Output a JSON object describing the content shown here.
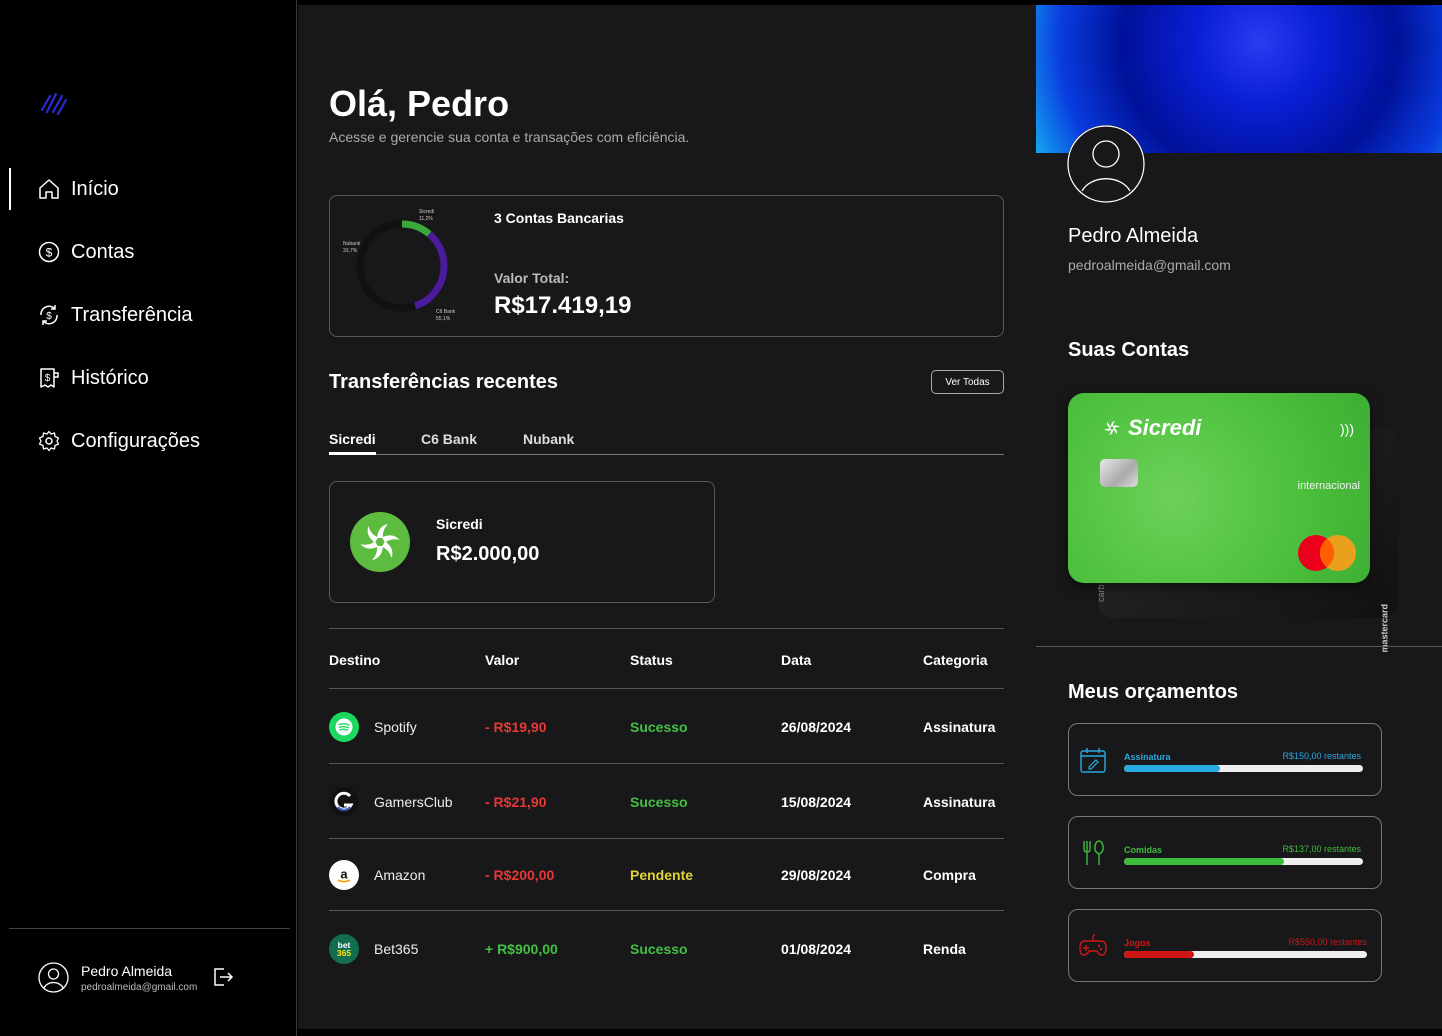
{
  "sidebar": {
    "nav": [
      {
        "label": "Início",
        "icon": "home-icon",
        "active": true
      },
      {
        "label": "Contas",
        "icon": "dollar-circle-icon"
      },
      {
        "label": "Transferência",
        "icon": "transfer-icon"
      },
      {
        "label": "Histórico",
        "icon": "receipt-icon"
      },
      {
        "label": "Configurações",
        "icon": "gear-icon"
      }
    ],
    "user": {
      "name": "Pedro Almeida",
      "email": "pedroalmeida@gmail.com"
    }
  },
  "main": {
    "greeting": "Olá, Pedro",
    "subtitle": "Acesse e gerencie sua conta e transações com eficiência.",
    "summary": {
      "accounts_label": "3 Contas Bancarias",
      "total_label": "Valor Total:",
      "total_value": "R$17.419,19",
      "donut": [
        {
          "name": "Sicredi",
          "pct": "11,2%",
          "value": 11.2,
          "color": "#3aa83a"
        },
        {
          "name": "Nubank",
          "pct": "33,7%",
          "value": 33.7,
          "color": "#4a1c9c"
        },
        {
          "name": "C6 Bank",
          "pct": "55,1%",
          "value": 55.1,
          "color": "#111111"
        }
      ]
    },
    "recent": {
      "title": "Transferências recentes",
      "see_all": "Ver Todas",
      "tabs": [
        "Sicredi",
        "C6 Bank",
        "Nubank"
      ],
      "account": {
        "name": "Sicredi",
        "balance": "R$2.000,00"
      }
    },
    "table": {
      "headers": [
        "Destino",
        "Valor",
        "Status",
        "Data",
        "Categoria"
      ],
      "rows": [
        {
          "dest": "Spotify",
          "icon": "spotify-icon",
          "value": "- R$19,90",
          "sign": "neg",
          "status": "Sucesso",
          "stype": "ok",
          "date": "26/08/2024",
          "cat": "Assinatura"
        },
        {
          "dest": "GamersClub",
          "icon": "gamersclub-icon",
          "value": "- R$21,90",
          "sign": "neg",
          "status": "Sucesso",
          "stype": "ok",
          "date": "15/08/2024",
          "cat": "Assinatura"
        },
        {
          "dest": "Amazon",
          "icon": "amazon-icon",
          "value": "- R$200,00",
          "sign": "neg",
          "status": "Pendente",
          "stype": "pend",
          "date": "29/08/2024",
          "cat": "Compra"
        },
        {
          "dest": "Bet365",
          "icon": "bet365-icon",
          "value": "+ R$900,00",
          "sign": "pos",
          "status": "Sucesso",
          "stype": "ok",
          "date": "01/08/2024",
          "cat": "Renda"
        }
      ]
    }
  },
  "profile": {
    "name": "Pedro Almeida",
    "email": "pedroalmeida@gmail.com",
    "accounts_title": "Suas Contas",
    "card": {
      "brand": "Sicredi",
      "type": "internacional",
      "back_text": "mastercard",
      "back_side": "carb"
    },
    "budgets_title": "Meus orçamentos",
    "budgets": [
      {
        "name": "Assinatura",
        "remaining": "R$150,00 restantes",
        "progress": 0.4,
        "color": "#29a9e1",
        "icon": "calendar-edit-icon"
      },
      {
        "name": "Comidas",
        "remaining": "R$137,00 restantes",
        "progress": 0.67,
        "color": "#3dbb3d",
        "icon": "fork-knife-icon"
      },
      {
        "name": "Jogos",
        "remaining": "R$550,00 restantes",
        "progress": 0.29,
        "color": "#d01515",
        "icon": "gamepad-icon"
      }
    ]
  }
}
